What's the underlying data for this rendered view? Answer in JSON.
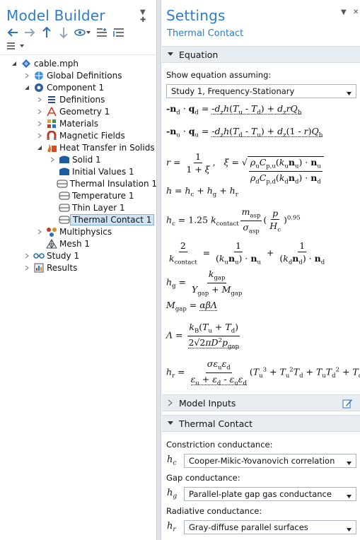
{
  "left_pane": {
    "title": "Model Builder",
    "tree": [
      {
        "label": "cable.mph",
        "level": 0,
        "icon": "model-file-icon",
        "twisty": "open"
      },
      {
        "label": "Global Definitions",
        "level": 1,
        "icon": "global-definitions-icon",
        "twisty": "closed"
      },
      {
        "label": "Component 1",
        "level": 1,
        "icon": "component-icon",
        "twisty": "open"
      },
      {
        "label": "Definitions",
        "level": 2,
        "icon": "definitions-icon",
        "twisty": "closed"
      },
      {
        "label": "Geometry 1",
        "level": 2,
        "icon": "geometry-icon",
        "twisty": "closed"
      },
      {
        "label": "Materials",
        "level": 2,
        "icon": "materials-icon",
        "twisty": "closed"
      },
      {
        "label": "Magnetic Fields",
        "level": 2,
        "icon": "magnetic-fields-icon",
        "twisty": "closed"
      },
      {
        "label": "Heat Transfer in Solids",
        "level": 2,
        "icon": "heat-transfer-icon",
        "twisty": "open"
      },
      {
        "label": "Solid 1",
        "level": 3,
        "icon": "solid-domain-icon",
        "twisty": "closed"
      },
      {
        "label": "Initial Values 1",
        "level": 3,
        "icon": "initial-values-icon",
        "twisty": "none"
      },
      {
        "label": "Thermal Insulation 1",
        "level": 3,
        "icon": "boundary-icon",
        "twisty": "none"
      },
      {
        "label": "Temperature 1",
        "level": 3,
        "icon": "boundary-icon",
        "twisty": "none"
      },
      {
        "label": "Thin Layer 1",
        "level": 3,
        "icon": "boundary-icon",
        "twisty": "none"
      },
      {
        "label": "Thermal Contact 1",
        "level": 3,
        "icon": "boundary-icon",
        "twisty": "none",
        "selected": true
      },
      {
        "label": "Multiphysics",
        "level": 2,
        "icon": "multiphysics-icon",
        "twisty": "closed"
      },
      {
        "label": "Mesh 1",
        "level": 2,
        "icon": "mesh-icon",
        "twisty": "none"
      },
      {
        "label": "Study 1",
        "level": 1,
        "icon": "study-icon",
        "twisty": "closed"
      },
      {
        "label": "Results",
        "level": 1,
        "icon": "results-icon",
        "twisty": "closed"
      }
    ]
  },
  "right_pane": {
    "title": "Settings",
    "subtitle": "Thermal Contact",
    "sections": {
      "equation": "Equation",
      "model_inputs": "Model Inputs",
      "thermal_contact": "Thermal Contact"
    },
    "show_equation_label": "Show equation assuming:",
    "show_equation_value": "Study 1, Frequency-Stationary",
    "constriction_label": "Constriction conductance:",
    "constriction_symbol": "h",
    "constriction_symbol_sub": "c",
    "constriction_value": "Cooper-Mikic-Yovanovich correlation",
    "gap_label": "Gap conductance:",
    "gap_symbol": "h",
    "gap_symbol_sub": "g",
    "gap_value": "Parallel-plate gap gas conductance",
    "radiative_label": "Radiative conductance:",
    "radiative_symbol": "h",
    "radiative_symbol_sub": "r",
    "radiative_value": "Gray-diffuse parallel surfaces"
  },
  "colors": {
    "accent": "#2e7dc9",
    "section_bg": "#e8edf2",
    "selection_bg": "#cfe3f7",
    "selection_border": "#7fb2e5"
  }
}
